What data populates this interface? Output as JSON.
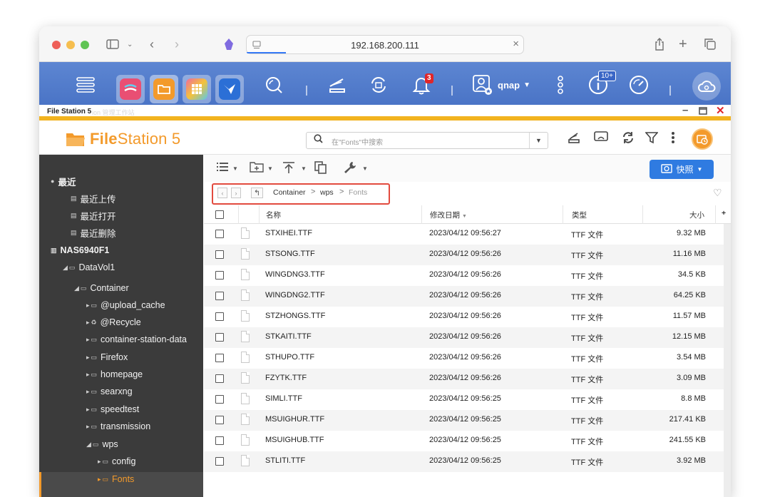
{
  "browser": {
    "url": "192.168.200.111"
  },
  "qnap_bar": {
    "notification_count": "3",
    "user": "qnap",
    "tasks_badge": "10+"
  },
  "window": {
    "title": "File Station 5",
    "ghost_title": "ion 管理工作站"
  },
  "app": {
    "logo_bold": "File",
    "logo_rest": "Station 5",
    "search_placeholder": "在\"Fonts\"中搜索",
    "snapshot_label": "快照"
  },
  "sidebar": {
    "recent": "最近",
    "recent_upload": "最近上传",
    "recent_open": "最近打开",
    "recent_delete": "最近删除",
    "nas": "NAS6940F1",
    "datavol": "DataVol1",
    "container": "Container",
    "folders": [
      "@upload_cache",
      "@Recycle",
      "container-station-data",
      "Firefox",
      "homepage",
      "searxng",
      "speedtest",
      "transmission",
      "wps"
    ],
    "wps_children": [
      "config",
      "Fonts"
    ]
  },
  "breadcrumb": [
    "Container",
    "wps",
    "Fonts"
  ],
  "table": {
    "headers": {
      "name": "名称",
      "modified": "修改日期",
      "type": "类型",
      "size": "大小"
    },
    "rows": [
      {
        "name": "STXIHEI.TTF",
        "modified": "2023/04/12 09:56:27",
        "type": "TTF 文件",
        "size": "9.32 MB"
      },
      {
        "name": "STSONG.TTF",
        "modified": "2023/04/12 09:56:26",
        "type": "TTF 文件",
        "size": "11.16 MB"
      },
      {
        "name": "WINGDNG3.TTF",
        "modified": "2023/04/12 09:56:26",
        "type": "TTF 文件",
        "size": "34.5 KB"
      },
      {
        "name": "WINGDNG2.TTF",
        "modified": "2023/04/12 09:56:26",
        "type": "TTF 文件",
        "size": "64.25 KB"
      },
      {
        "name": "STZHONGS.TTF",
        "modified": "2023/04/12 09:56:26",
        "type": "TTF 文件",
        "size": "11.57 MB"
      },
      {
        "name": "STKAITI.TTF",
        "modified": "2023/04/12 09:56:26",
        "type": "TTF 文件",
        "size": "12.15 MB"
      },
      {
        "name": "STHUPO.TTF",
        "modified": "2023/04/12 09:56:26",
        "type": "TTF 文件",
        "size": "3.54 MB"
      },
      {
        "name": "FZYTK.TTF",
        "modified": "2023/04/12 09:56:26",
        "type": "TTF 文件",
        "size": "3.09 MB"
      },
      {
        "name": "SIMLI.TTF",
        "modified": "2023/04/12 09:56:25",
        "type": "TTF 文件",
        "size": "8.8 MB"
      },
      {
        "name": "MSUIGHUR.TTF",
        "modified": "2023/04/12 09:56:25",
        "type": "TTF 文件",
        "size": "217.41 KB"
      },
      {
        "name": "MSUIGHUB.TTF",
        "modified": "2023/04/12 09:56:25",
        "type": "TTF 文件",
        "size": "241.55 KB"
      },
      {
        "name": "STLITI.TTF",
        "modified": "2023/04/12 09:56:25",
        "type": "TTF 文件",
        "size": "3.92 MB"
      }
    ]
  },
  "colors": {
    "accent_orange": "#f39a2b",
    "qnap_blue": "#4a74c6",
    "sidebar_bg": "#3b3b3b",
    "snapshot_blue": "#2f7be1",
    "highlight_red": "#e24a3e"
  }
}
